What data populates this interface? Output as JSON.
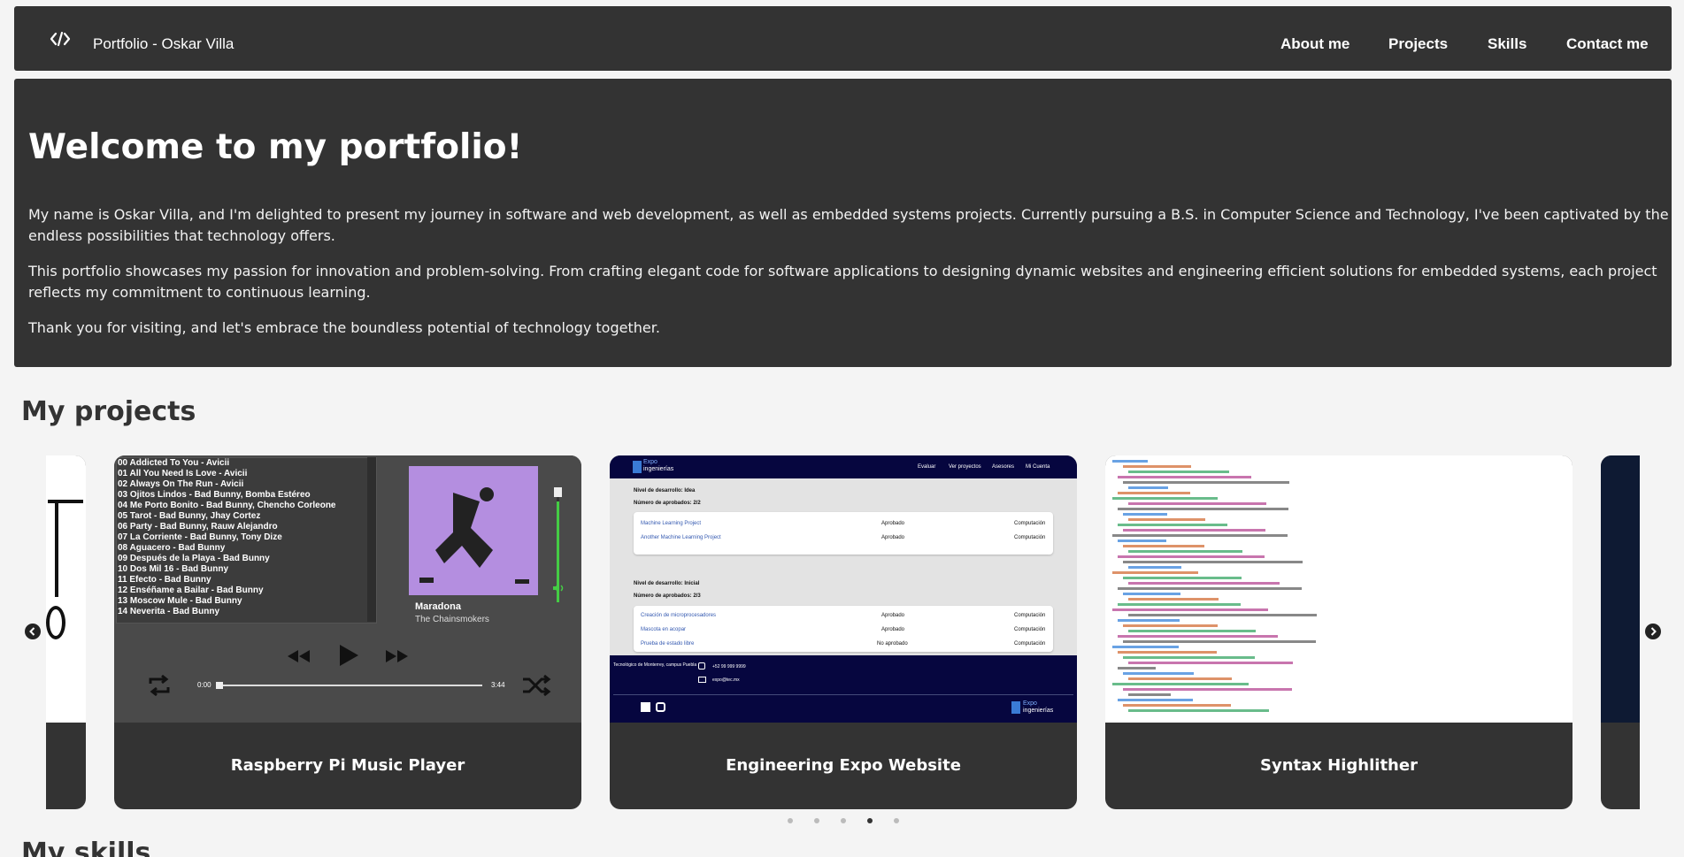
{
  "navbar": {
    "brand_icon": "code-brackets-icon",
    "brand": "Portfolio - Oskar Villa",
    "links": [
      "About me",
      "Projects",
      "Skills",
      "Contact me"
    ]
  },
  "intro": {
    "heading": "Welcome to my portfolio!",
    "paragraphs": [
      "My name is Oskar Villa, and I'm delighted to present my journey in software and web development, as well as embedded systems projects. Currently pursuing a B.S. in Computer Science and Technology, I've been captivated by the endless possibilities that technology offers.",
      "This portfolio showcases my passion for innovation and problem-solving. From crafting elegant code for software applications to designing dynamic websites and engineering efficient solutions for embedded systems, each project reflects my commitment to continuous learning.",
      "Thank you for visiting, and let's embrace the boundless potential of technology together."
    ]
  },
  "projects": {
    "title": "My projects",
    "cards": [
      {
        "title": "Raspberry Pi Music Player"
      },
      {
        "title": "Engineering Expo Website"
      },
      {
        "title": "Syntax Highlither"
      }
    ],
    "prev_icon": "chevron-left-icon",
    "next_icon": "chevron-right-icon",
    "dots": 5,
    "active_dot": 4
  },
  "music_player": {
    "playlist": [
      "00 Addicted To You - Avicii",
      "01 All You Need Is Love - Avicii",
      "02 Always On The Run - Avicii",
      "03 Ojitos Lindos - Bad Bunny, Bomba Estéreo",
      "04 Me Porto Bonito - Bad Bunny, Chencho Corleone",
      "05 Tarot - Bad Bunny, Jhay Cortez",
      "06 Party - Bad Bunny, Rauw Alejandro",
      "07 La Corriente - Bad Bunny, Tony Dize",
      "08 Aguacero - Bad Bunny",
      "09 Después de la Playa - Bad Bunny",
      "10 Dos Mil 16 - Bad Bunny",
      "11 Efecto - Bad Bunny",
      "12 Enséñame a Bailar - Bad Bunny",
      "13 Moscow Mule - Bad Bunny",
      "14 Neverita - Bad Bunny"
    ],
    "song": "Maradona",
    "artist": "The Chainsmokers",
    "time_start": "0:00",
    "time_end": "3:44"
  },
  "expo": {
    "brand_line1": "Expo",
    "brand_line2": "ingenierías",
    "nav": [
      "Evaluar",
      "Ver proyectos",
      "Asesores",
      "Mi Cuenta"
    ],
    "section1_title": "Nivel de desarrollo: Idea",
    "section1_sub": "Número de aprobados: 2/2",
    "section1_rows": [
      [
        "Machine Learning Project",
        "Aprobado",
        "Computación"
      ],
      [
        "Another Machine Learning Project",
        "Aprobado",
        "Computación"
      ]
    ],
    "section2_title": "Nivel de desarrollo: Inicial",
    "section2_sub": "Número de aprobados: 2/3",
    "section2_rows": [
      [
        "Creación de microprocesadores",
        "Aprobado",
        "Computación"
      ],
      [
        "Mascota en acopar",
        "Aprobado",
        "Computación"
      ],
      [
        "Prueba de estado libre",
        "No aprobado",
        "Computación"
      ]
    ],
    "footer_org": "Tecnológico de Monterrey, campus Puebla",
    "footer_phone": "+52 99 999 9999",
    "footer_email": "expo@tec.mx"
  },
  "skills": {
    "title": "My skills"
  },
  "colors": {
    "panel": "#333333",
    "background": "#f4f4f4",
    "expo_navy": "#06063f",
    "volume_green": "#44cc44"
  }
}
